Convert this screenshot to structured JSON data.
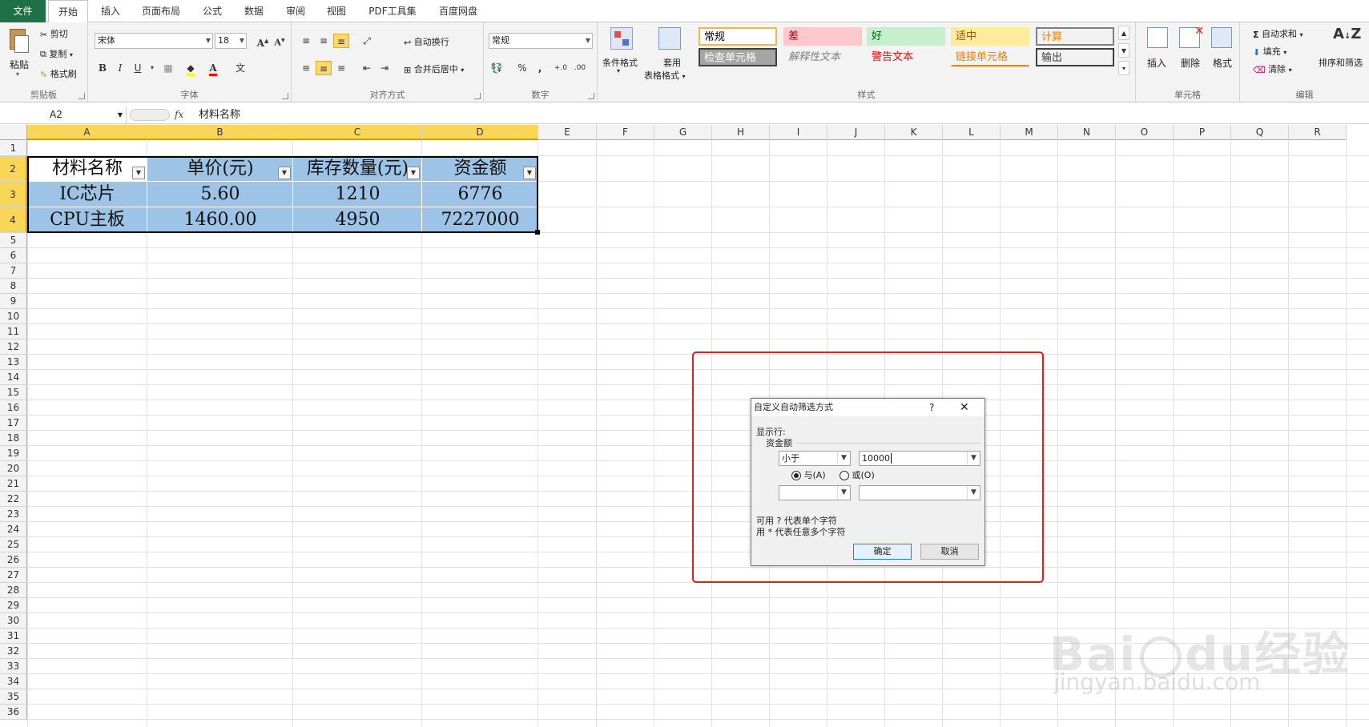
{
  "tabs": [
    "文件",
    "开始",
    "插入",
    "页面布局",
    "公式",
    "数据",
    "审阅",
    "视图",
    "PDF工具集",
    "百度网盘"
  ],
  "ribbon": {
    "clipboard": {
      "paste": "粘贴",
      "cut": "剪切",
      "copy": "复制",
      "painter": "格式刷",
      "label": "剪贴板"
    },
    "font": {
      "name": "宋体",
      "size": "18",
      "label": "字体"
    },
    "align": {
      "wrap": "自动换行",
      "merge": "合并后居中",
      "label": "对齐方式"
    },
    "number": {
      "format": "常规",
      "label": "数字"
    },
    "styles": {
      "cond": "条件格式",
      "table_l1": "套用",
      "table_l2": "表格格式",
      "label": "样式",
      "cells": [
        {
          "text": "常规",
          "bg": "#ffffff",
          "color": "#000000",
          "border": "#f2b84b"
        },
        {
          "text": "差",
          "bg": "#ffc7ce",
          "color": "#9c0006"
        },
        {
          "text": "好",
          "bg": "#c6efce",
          "color": "#006100"
        },
        {
          "text": "适中",
          "bg": "#ffeb9c",
          "color": "#9c5700"
        },
        {
          "text": "计算",
          "bg": "#f2f2f2",
          "color": "#fa7d00",
          "border": "#7f7f7f"
        },
        {
          "text": "检查单元格",
          "bg": "#a5a5a5",
          "color": "#ffffff",
          "border": "#3f3f3f"
        },
        {
          "text": "解释性文本",
          "bg": "transparent",
          "color": "#7f7f7f"
        },
        {
          "text": "警告文本",
          "bg": "transparent",
          "color": "#ff0000"
        },
        {
          "text": "链接单元格",
          "bg": "transparent",
          "color": "#fa7d00",
          "underline": "#ff8001"
        },
        {
          "text": "输出",
          "bg": "#f2f2f2",
          "color": "#3f3f3f",
          "border": "#3f3f3f"
        }
      ]
    },
    "cellgroup": {
      "insert": "插入",
      "delete": "删除",
      "format": "格式",
      "label": "单元格"
    },
    "edit": {
      "autosum": "自动求和",
      "fill": "填充",
      "clear": "清除",
      "sort": "排序和筛选",
      "label": "编辑"
    }
  },
  "formula": {
    "namebox": "A2",
    "fx": "fx",
    "content": "材料名称"
  },
  "columns": [
    "A",
    "B",
    "C",
    "D",
    "E",
    "F",
    "G",
    "H",
    "I",
    "J",
    "K",
    "L",
    "M",
    "N",
    "O",
    "P",
    "Q",
    "R"
  ],
  "rows": [
    "1",
    "2",
    "3",
    "4",
    "5",
    "6",
    "7",
    "8",
    "9",
    "10",
    "11",
    "12",
    "13",
    "14",
    "15",
    "16",
    "17",
    "18",
    "19",
    "20",
    "21",
    "22",
    "23",
    "24",
    "25",
    "26",
    "27",
    "28",
    "29",
    "30",
    "31",
    "32",
    "33",
    "34",
    "35",
    "36"
  ],
  "table": {
    "headers": [
      "材料名称",
      "单价(元)",
      "库存数量(元)",
      "资金额"
    ],
    "rows": [
      [
        "IC芯片",
        "5.60",
        "1210",
        "6776"
      ],
      [
        "CPU主板",
        "1460.00",
        "4950",
        "7227000"
      ]
    ]
  },
  "dialog": {
    "title": "自定义自动筛选方式",
    "help": "?",
    "close": "✕",
    "show_rows": "显示行:",
    "field": "资金额",
    "op1": "小于",
    "val1": "10000",
    "and": "与(A)",
    "or": "或(O)",
    "op2": "",
    "val2": "",
    "hint1": "可用 ? 代表单个字符",
    "hint2": "用 * 代表任意多个字符",
    "ok": "确定",
    "cancel": "取消"
  },
  "watermark": {
    "logo": "Bai du经验",
    "url": "jingyan.baidu.com"
  }
}
